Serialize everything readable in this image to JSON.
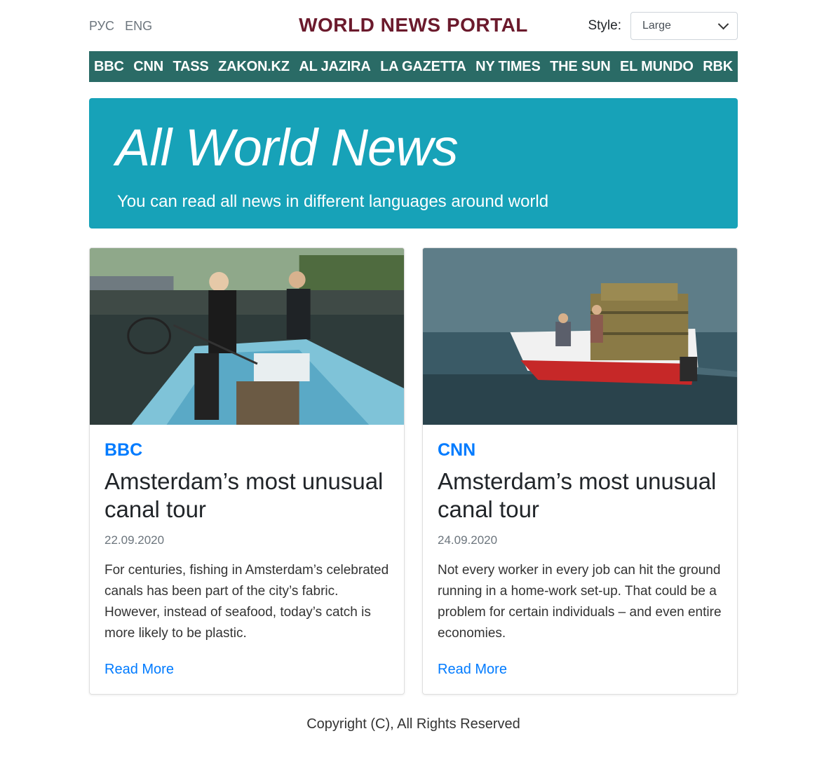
{
  "header": {
    "languages": [
      "РУС",
      "ENG"
    ],
    "brand": "WORLD NEWS PORTAL",
    "style_label": "Style:",
    "style_selected": "Large"
  },
  "nav": {
    "items": [
      "BBC",
      "CNN",
      "TASS",
      "ZAKON.KZ",
      "AL JAZIRA",
      "LA GAZETTA",
      "NY TIMES",
      "THE SUN",
      "EL MUNDO",
      "RBK"
    ]
  },
  "hero": {
    "title": "All World News",
    "subtitle": "You can read all news in different languages around world"
  },
  "cards": [
    {
      "source": "BBC",
      "title": "Amsterdam’s most unusual canal tour",
      "date": "22.09.2020",
      "text": "For centuries, fishing in Amsterdam’s celebrated canals has been part of the city’s fabric. However, instead of seafood, today’s catch is more likely to be plastic.",
      "link": "Read More"
    },
    {
      "source": "CNN",
      "title": "Amsterdam’s most unusual canal tour",
      "date": "24.09.2020",
      "text": "Not every worker in every job can hit the ground running in a home-work set-up. That could be a problem for certain individuals – and even entire economies.",
      "link": "Read More"
    }
  ],
  "footer": {
    "text": "Copyright (C), All Rights Reserved"
  },
  "colors": {
    "brand": "#6b1a2c",
    "nav_bg": "#2a6b66",
    "hero_bg": "#17a2b8",
    "link": "#007bff"
  }
}
